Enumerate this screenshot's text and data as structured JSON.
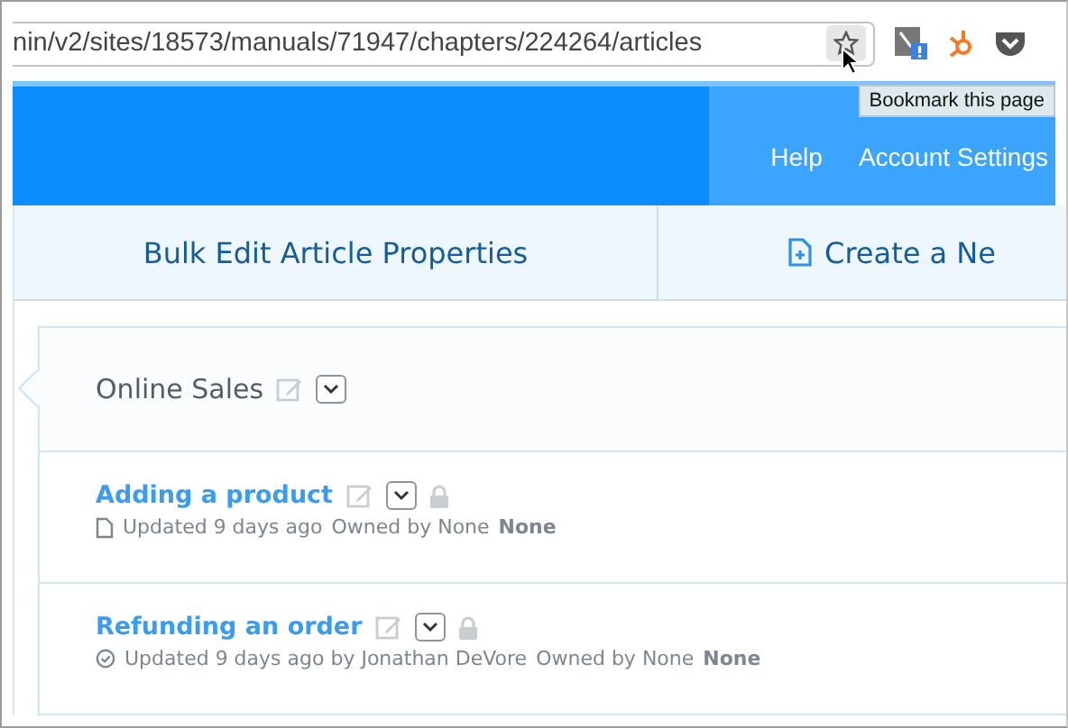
{
  "browser": {
    "url": "nin/v2/sites/18573/manuals/71947/chapters/224264/articles",
    "tooltip": "Bookmark this page"
  },
  "nav": {
    "links": [
      "Help",
      "Account Settings"
    ]
  },
  "toolbar": {
    "actions": [
      {
        "label": "Bulk Edit Article Properties",
        "kind": "plain"
      },
      {
        "label": "Create a Ne",
        "kind": "create"
      }
    ]
  },
  "chapter": {
    "title": "Online Sales"
  },
  "articles": [
    {
      "title": "Adding a product",
      "kind": "draft",
      "updated": "Updated 9 days ago",
      "owned": "Owned by None",
      "owner": "None"
    },
    {
      "title": "Refunding an order",
      "kind": "published",
      "updated": "Updated 9 days ago by Jonathan DeVore",
      "owned": "Owned by None",
      "owner": "None"
    }
  ]
}
